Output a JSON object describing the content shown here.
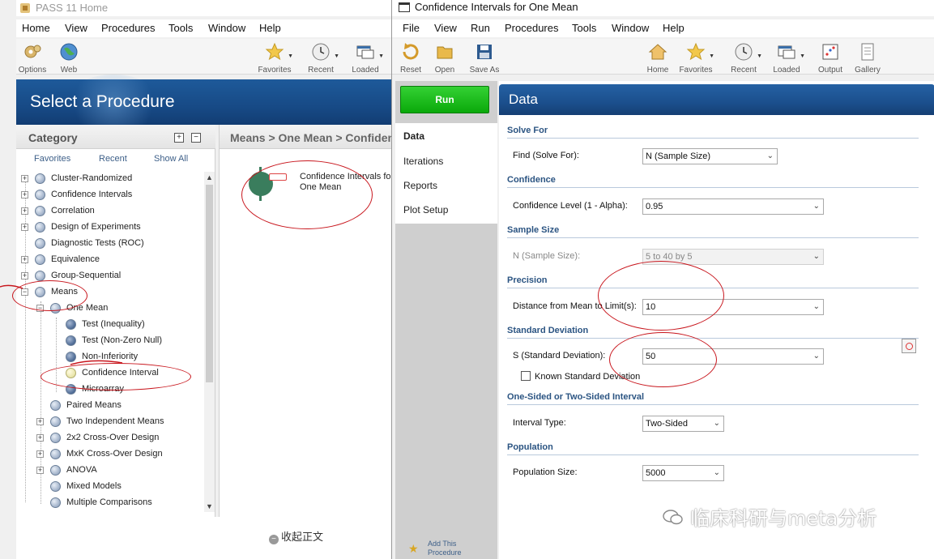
{
  "home": {
    "title": "PASS 11 Home",
    "menu": [
      "Home",
      "View",
      "Procedures",
      "Tools",
      "Window",
      "Help"
    ],
    "toolbar": {
      "options": "Options",
      "web": "Web",
      "favorites": "Favorites",
      "recent": "Recent",
      "loaded": "Loaded"
    },
    "banner_title": "Select a Procedure",
    "category": {
      "title": "Category",
      "tabs": [
        "Favorites",
        "Recent",
        "Show All"
      ],
      "tree": [
        "Cluster-Randomized",
        "Confidence Intervals",
        "Correlation",
        "Design of Experiments",
        "Diagnostic Tests (ROC)",
        "Equivalence",
        "Group-Sequential",
        "Means",
        "One Mean",
        "Test (Inequality)",
        "Test (Non-Zero Null)",
        "Non-Inferiority",
        "Confidence Interval",
        "Microarray",
        "Paired Means",
        "Two Independent Means",
        "2x2 Cross-Over Design",
        "MxK Cross-Over Design",
        "ANOVA",
        "Mixed Models",
        "Multiple Comparisons"
      ]
    },
    "breadcrumb": "Means > One Mean > Confidence Intervals",
    "procedure_item": "Confidence Intervals for One Mean",
    "collapse_text": "收起正文"
  },
  "ci": {
    "title": "Confidence Intervals for One Mean",
    "menu": [
      "File",
      "View",
      "Run",
      "Procedures",
      "Tools",
      "Window",
      "Help"
    ],
    "toolbar": {
      "reset": "Reset",
      "open": "Open",
      "save_as": "Save As",
      "home": "Home",
      "favorites": "Favorites",
      "recent": "Recent",
      "loaded": "Loaded",
      "output": "Output",
      "gallery": "Gallery"
    },
    "run_label": "Run",
    "side_tabs": [
      "Data",
      "Iterations",
      "Reports",
      "Plot Setup"
    ],
    "add_procedure": "Add This Procedure to",
    "panel_title": "Data",
    "sections": {
      "solve_for": "Solve For",
      "confidence": "Confidence",
      "sample_size": "Sample Size",
      "precision": "Precision",
      "std_dev": "Standard Deviation",
      "interval": "One-Sided or Two-Sided Interval",
      "population": "Population"
    },
    "fields": {
      "find_label": "Find (Solve For):",
      "find_value": "N (Sample Size)",
      "conf_label": "Confidence Level (1 - Alpha):",
      "conf_value": "0.95",
      "n_label": "N (Sample Size):",
      "n_value": "5 to 40 by 5",
      "dist_label": "Distance from Mean to Limit(s):",
      "dist_value": "10",
      "s_label": "S (Standard Deviation):",
      "s_value": "50",
      "known_sd_label": "Known Standard Deviation",
      "interval_label": "Interval Type:",
      "interval_value": "Two-Sided",
      "pop_label": "Population Size:",
      "pop_value": "5000"
    }
  },
  "watermark": "临床科研与meta分析",
  "colors": {
    "banner_blue": "#1b4f8d",
    "run_green": "#12b512",
    "section_blue": "#2b5482",
    "annotation_red": "#c8161d"
  }
}
